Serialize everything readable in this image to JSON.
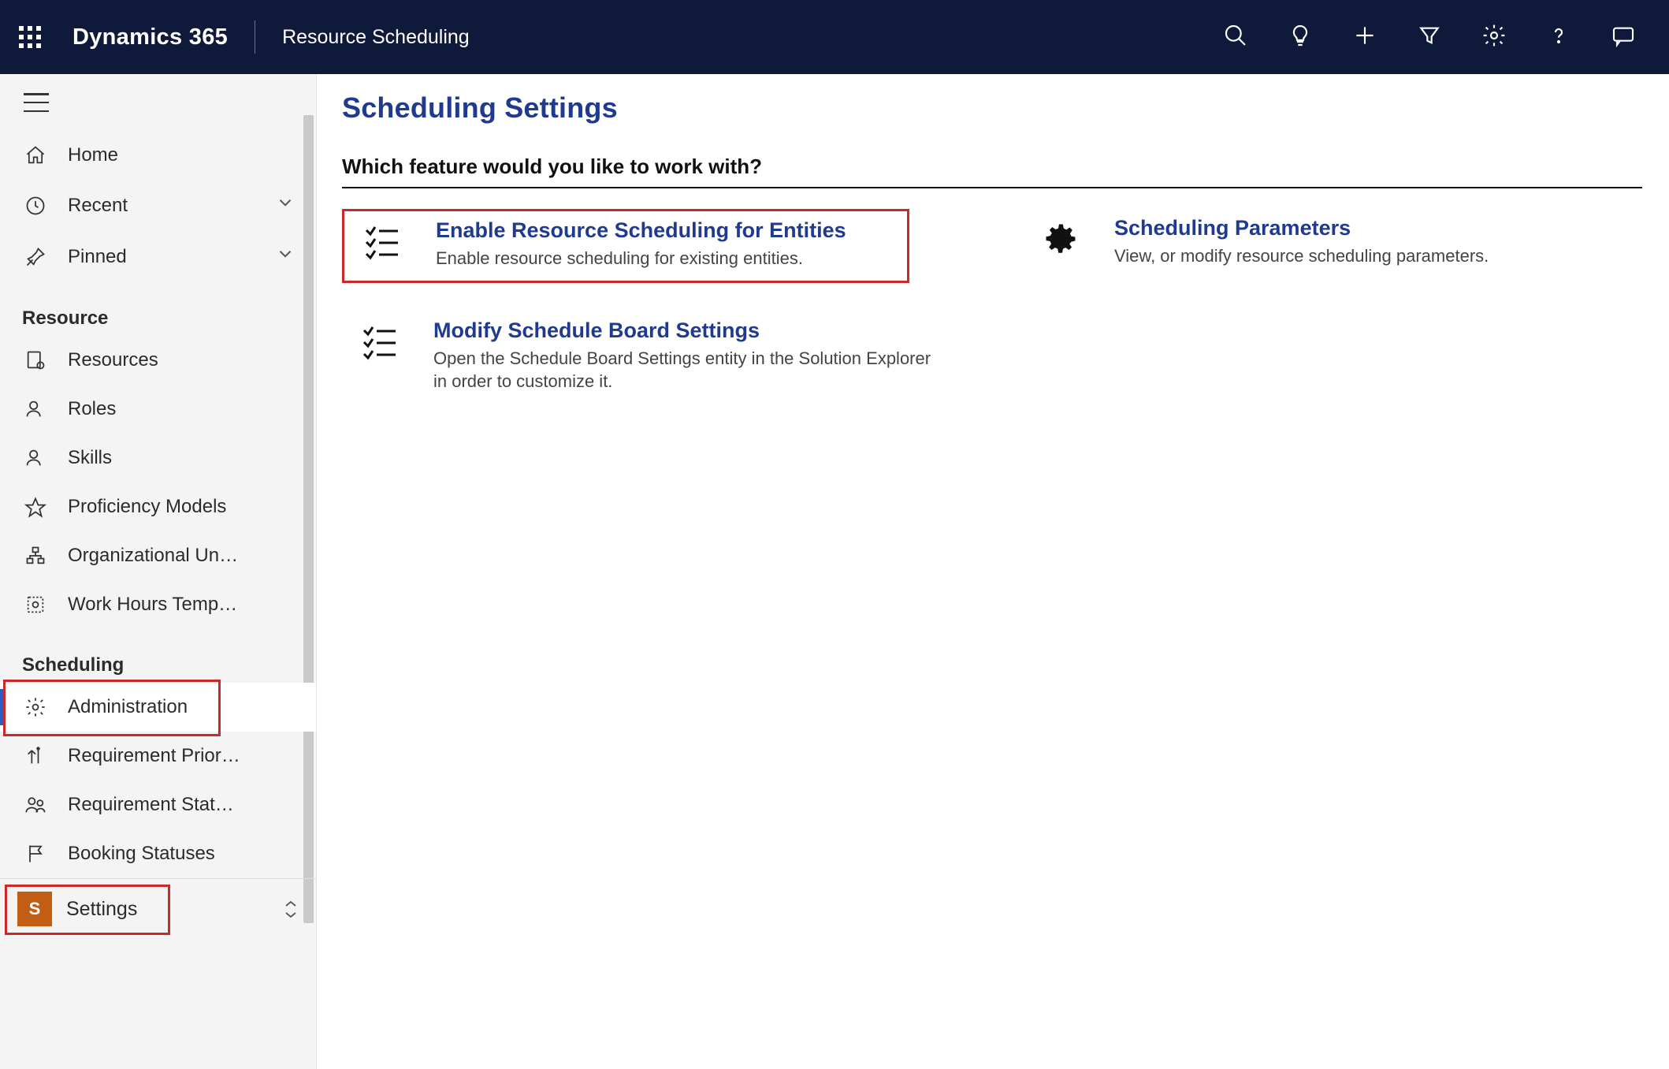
{
  "header": {
    "brand": "Dynamics 365",
    "app": "Resource Scheduling"
  },
  "sidebar": {
    "top": [
      {
        "label": "Home"
      },
      {
        "label": "Recent"
      },
      {
        "label": "Pinned"
      }
    ],
    "sections": [
      {
        "title": "Resource",
        "items": [
          {
            "label": "Resources"
          },
          {
            "label": "Roles"
          },
          {
            "label": "Skills"
          },
          {
            "label": "Proficiency Models"
          },
          {
            "label": "Organizational Un…"
          },
          {
            "label": "Work Hours Temp…"
          }
        ]
      },
      {
        "title": "Scheduling",
        "items": [
          {
            "label": "Administration"
          },
          {
            "label": "Requirement Prior…"
          },
          {
            "label": "Requirement Stat…"
          },
          {
            "label": "Booking Statuses"
          }
        ]
      }
    ],
    "area": {
      "badge": "S",
      "label": "Settings"
    }
  },
  "main": {
    "title": "Scheduling Settings",
    "question": "Which feature would you like to work with?",
    "tiles": {
      "col1": [
        {
          "title": "Enable Resource Scheduling for Entities",
          "desc": "Enable resource scheduling for existing entities."
        },
        {
          "title": "Modify Schedule Board Settings",
          "desc": "Open the Schedule Board Settings entity in the Solution Explorer in order to customize it."
        }
      ],
      "col2": [
        {
          "title": "Scheduling Parameters",
          "desc": "View, or modify resource scheduling parameters."
        }
      ]
    }
  }
}
